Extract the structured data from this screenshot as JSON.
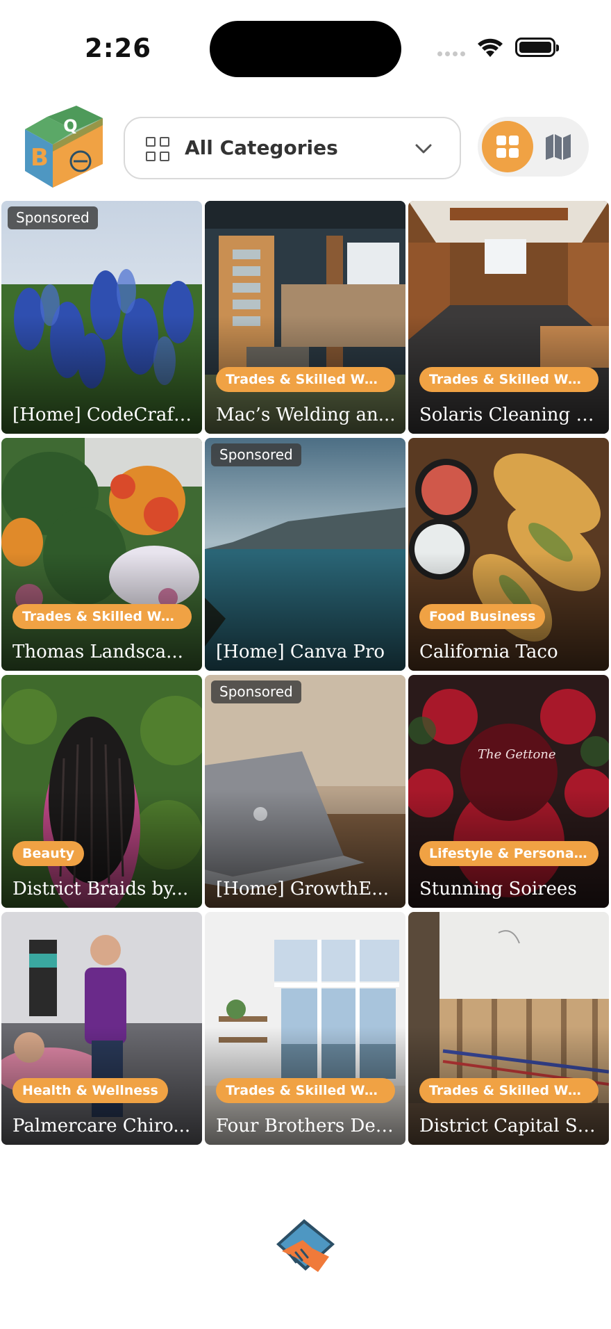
{
  "status": {
    "time": "2:26"
  },
  "header": {
    "category_label": "All Categories",
    "icons": {
      "logo": "qollaby-block-logo",
      "category": "grid-outline-icon",
      "dropdown": "chevron-down-icon",
      "grid_view": "grid-view-icon",
      "map_view": "map-icon"
    },
    "colors": {
      "accent": "#f0a244"
    }
  },
  "tiles": [
    {
      "title": "[Home] CodeCraft...",
      "badge": "",
      "sponsored": "Sponsored"
    },
    {
      "title": "Mac’s Welding an...",
      "badge": "Trades & Skilled Work",
      "sponsored": ""
    },
    {
      "title": "Solaris Cleaning S...",
      "badge": "Trades & Skilled Work",
      "sponsored": ""
    },
    {
      "title": "Thomas Landsca...",
      "badge": "Trades & Skilled Work",
      "sponsored": ""
    },
    {
      "title": "[Home] Canva Pro",
      "badge": "",
      "sponsored": "Sponsored"
    },
    {
      "title": "California Taco",
      "badge": "Food Business",
      "sponsored": ""
    },
    {
      "title": "District Braids by...",
      "badge": "Beauty",
      "sponsored": ""
    },
    {
      "title": "[Home] GrowthE...",
      "badge": "",
      "sponsored": "Sponsored"
    },
    {
      "title": "Stunning Soirees",
      "badge": "Lifestyle & Personal Se...",
      "sponsored": ""
    },
    {
      "title": "Palmercare Chiro...",
      "badge": "Health & Wellness",
      "sponsored": ""
    },
    {
      "title": "Four Brothers Des...",
      "badge": "Trades & Skilled Work",
      "sponsored": ""
    },
    {
      "title": "District Capital Se...",
      "badge": "Trades & Skilled Work",
      "sponsored": ""
    }
  ],
  "footer": {
    "icon": "handshake-icon"
  }
}
